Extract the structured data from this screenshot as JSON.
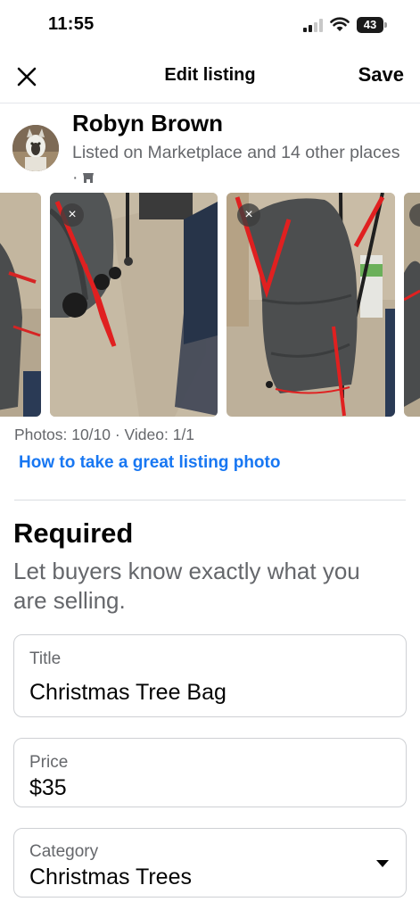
{
  "status_bar": {
    "time": "11:55",
    "battery": "43"
  },
  "header": {
    "title": "Edit listing",
    "save_label": "Save",
    "close_icon": "close-icon"
  },
  "profile": {
    "name": "Robyn Brown",
    "subtitle": "Listed on Marketplace and 14 other places ·",
    "icon": "marketplace-shop-icon"
  },
  "photos": {
    "count_text": "Photos: 10/10 · Video: 1/1",
    "tip_link": "How to take a great listing photo",
    "remove_label": "×"
  },
  "required": {
    "title": "Required",
    "description": "Let buyers know exactly what you are selling."
  },
  "fields": {
    "title": {
      "label": "Title",
      "value": "Christmas Tree Bag"
    },
    "price": {
      "label": "Price",
      "value": "$35"
    },
    "category": {
      "label": "Category",
      "value": "Christmas Trees"
    }
  },
  "colors": {
    "link": "#1877f2",
    "secondary_text": "#65676b",
    "primary_text": "#050505"
  }
}
